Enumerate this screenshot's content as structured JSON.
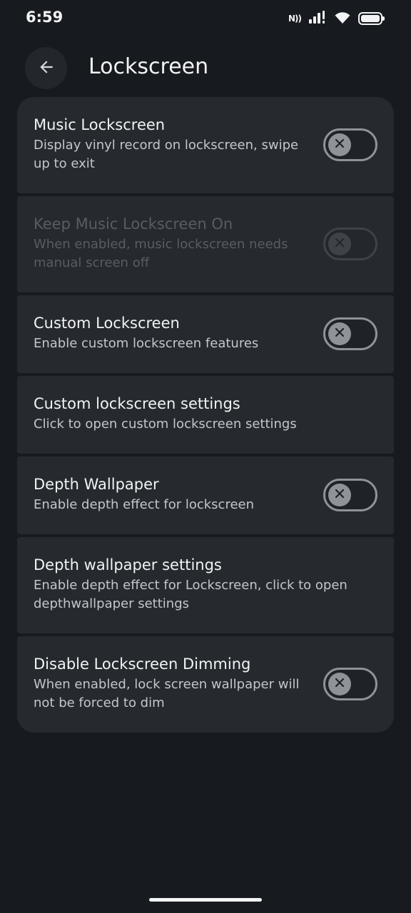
{
  "status_bar": {
    "time": "6:59",
    "nfc_label": "N))",
    "battery_level_percent": 100
  },
  "header": {
    "title": "Lockscreen"
  },
  "settings": [
    {
      "title": "Music Lockscreen",
      "description": "Display vinyl record on lockscreen, swipe up to exit",
      "has_toggle": true,
      "toggle_on": false,
      "enabled": true
    },
    {
      "title": "Keep Music Lockscreen On",
      "description": "When enabled, music lockscreen needs manual screen off",
      "has_toggle": true,
      "toggle_on": false,
      "enabled": false
    },
    {
      "title": "Custom Lockscreen",
      "description": "Enable custom lockscreen features",
      "has_toggle": true,
      "toggle_on": false,
      "enabled": true
    },
    {
      "title": "Custom lockscreen settings",
      "description": "Click to open custom lockscreen settings",
      "has_toggle": false,
      "enabled": true
    },
    {
      "title": "Depth Wallpaper",
      "description": "Enable depth effect for lockscreen",
      "has_toggle": true,
      "toggle_on": false,
      "enabled": true
    },
    {
      "title": "Depth wallpaper settings",
      "description": "Enable depth effect for Lockscreen, click to open depthwallpaper settings",
      "has_toggle": false,
      "enabled": true
    },
    {
      "title": "Disable Lockscreen Dimming",
      "description": "When enabled, lock screen wallpaper will not be forced to dim",
      "has_toggle": true,
      "toggle_on": false,
      "enabled": true
    }
  ],
  "icons": {
    "back": "arrow-back-icon",
    "toggle_off": "close-icon",
    "nfc": "nfc-icon",
    "signal": "signal-icon",
    "wifi": "wifi-icon",
    "battery": "battery-icon"
  },
  "colors": {
    "background": "#171a1e",
    "card": "#262a2f",
    "text_primary": "#f1f3f4",
    "text_secondary": "#c3c6cb",
    "text_disabled": "#595c61",
    "toggle_off": "#8f9398"
  }
}
